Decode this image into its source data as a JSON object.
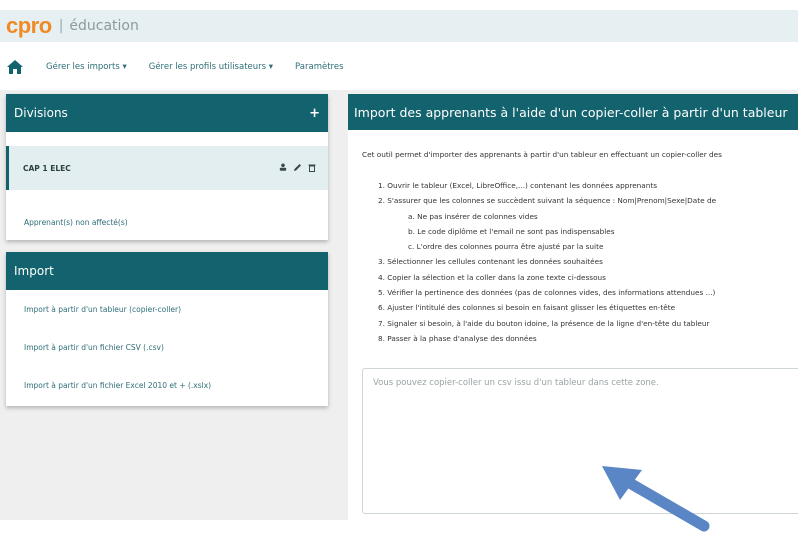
{
  "brand": {
    "logo": "cpro",
    "separator": "|",
    "subtitle": "éducation"
  },
  "nav": {
    "home_icon": "home-icon",
    "items": [
      "Gérer les imports ▾",
      "Gérer les profils utilisateurs ▾",
      "Paramètres"
    ]
  },
  "divisions": {
    "title": "Divisions",
    "add_label": "+",
    "selected": "CAP 1 ELEC",
    "row_icons": [
      "user-icon",
      "edit-icon",
      "trash-icon"
    ],
    "unassigned": "Apprenant(s) non affecté(s)"
  },
  "import_panel": {
    "title": "Import",
    "links": [
      "Import à partir d'un tableur (copier-coller)",
      "Import à partir d'un fichier CSV (.csv)",
      "Import à partir d'un fichier Excel 2010 et + (.xslx)"
    ]
  },
  "main": {
    "title": "Import des apprenants à l'aide d'un copier-coller à partir d'un tableur",
    "intro": "Cet outil permet d'importer des apprenants à partir d'un tableur en effectuant un copier-coller des",
    "steps": [
      "1. Ouvrir le tableur (Excel, LibreOffice,...) contenant les données apprenants",
      "2. S'assurer que les colonnes se succèdent suivant la séquence : Nom|Prenom|Sexe|Date de",
      "a. Ne pas insérer de colonnes vides",
      "b. Le code diplôme et l'email ne sont pas indispensables",
      "c. L'ordre des colonnes pourra être ajusté par la suite",
      "3. Sélectionner les cellules contenant les données souhaitées",
      "4. Copier la sélection et la coller dans la zone texte ci-dessous",
      "5. Vérifier la pertinence des données (pas de colonnes vides, des informations attendues ...)",
      "6. Ajuster l'intitulé des colonnes si besoin en faisant glisser les étiquettes en-tête",
      "7. Signaler si besoin, à l'aide du bouton idoine, la présence de la ligne d'en-tête du tableur",
      "8. Passer à la phase d'analyse des données"
    ],
    "textarea_placeholder": "Vous pouvez copier-coller un csv issu d'un tableur dans cette zone."
  },
  "colors": {
    "teal": "#13636e",
    "orange": "#f08a24",
    "arrow": "#5b86c5"
  }
}
